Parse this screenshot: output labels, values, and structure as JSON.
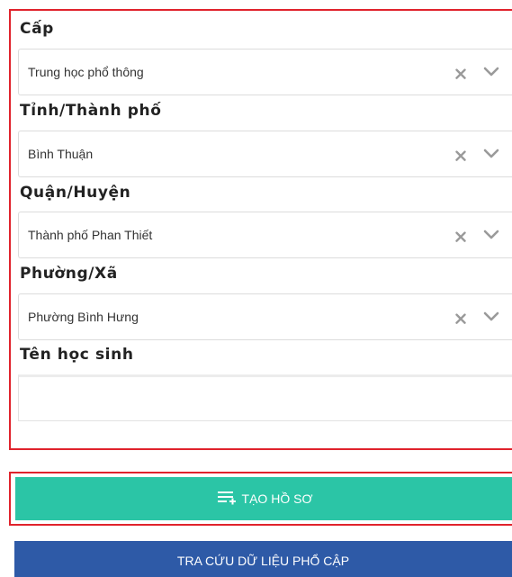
{
  "form": {
    "level": {
      "label": "Cấp",
      "value": "Trung học phổ thông"
    },
    "province": {
      "label": "Tỉnh/Thành phố",
      "value": "Bình Thuận"
    },
    "district": {
      "label": "Quận/Huyện",
      "value": "Thành phố Phan Thiết"
    },
    "ward": {
      "label": "Phường/Xã",
      "value": "Phường Bình Hưng"
    },
    "student_name": {
      "label": "Tên học sinh",
      "value": ""
    }
  },
  "icons": {
    "clear": "close-icon",
    "dropdown": "chevron-down-icon",
    "create": "playlist-add-icon"
  },
  "actions": {
    "create_label": "TẠO HỒ SƠ",
    "lookup_label": "TRA CỨU DỮ LIỆU PHỔ CẬP"
  },
  "colors": {
    "highlight_border": "#e0232c",
    "create_button": "#2bc5a6",
    "lookup_button": "#2e5aa7",
    "icon_gray": "#9a9a9a"
  }
}
